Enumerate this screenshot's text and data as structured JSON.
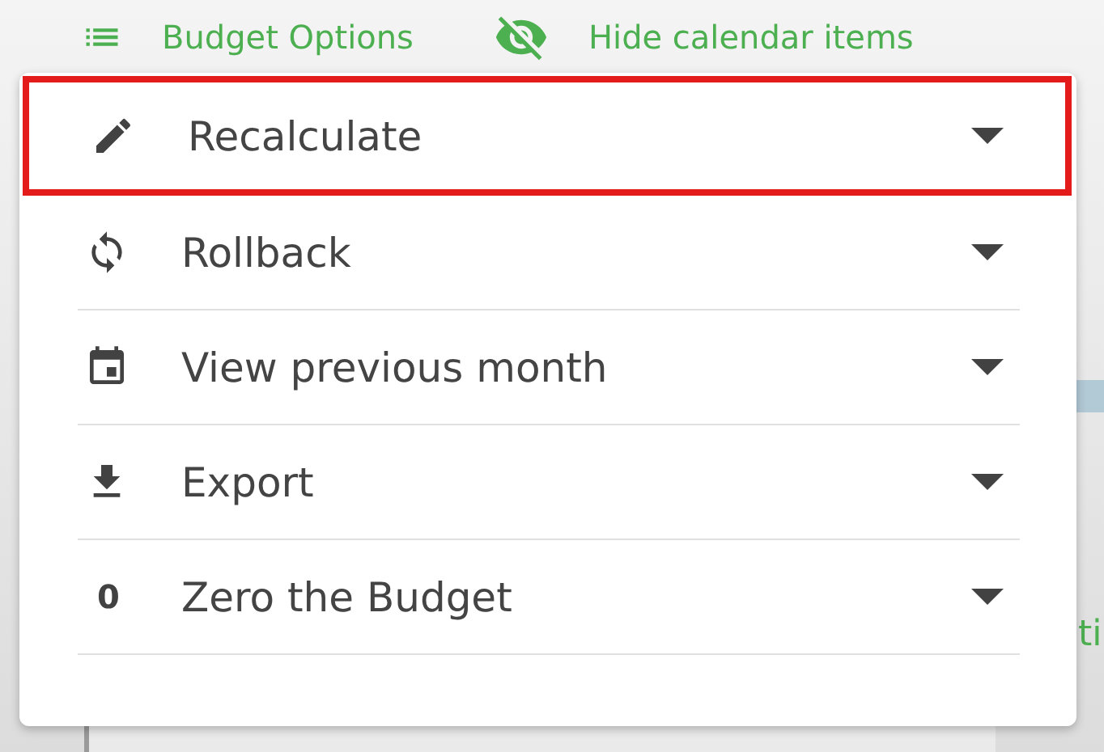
{
  "toolbar": [
    {
      "kind": "list",
      "label": "Budget Options"
    },
    {
      "kind": "eye-off",
      "label": "Hide calendar items"
    }
  ],
  "menu": {
    "items": [
      {
        "kind": "pencil",
        "label": "Recalculate",
        "highlighted": true
      },
      {
        "kind": "sync",
        "label": "Rollback",
        "highlighted": false
      },
      {
        "kind": "calendar",
        "label": "View previous month",
        "highlighted": false
      },
      {
        "kind": "download",
        "label": "Export",
        "highlighted": false
      },
      {
        "kind": "text",
        "glyph": "0",
        "label": "Zero the Budget",
        "highlighted": false
      }
    ]
  },
  "background": {
    "partial_text": "ti"
  }
}
